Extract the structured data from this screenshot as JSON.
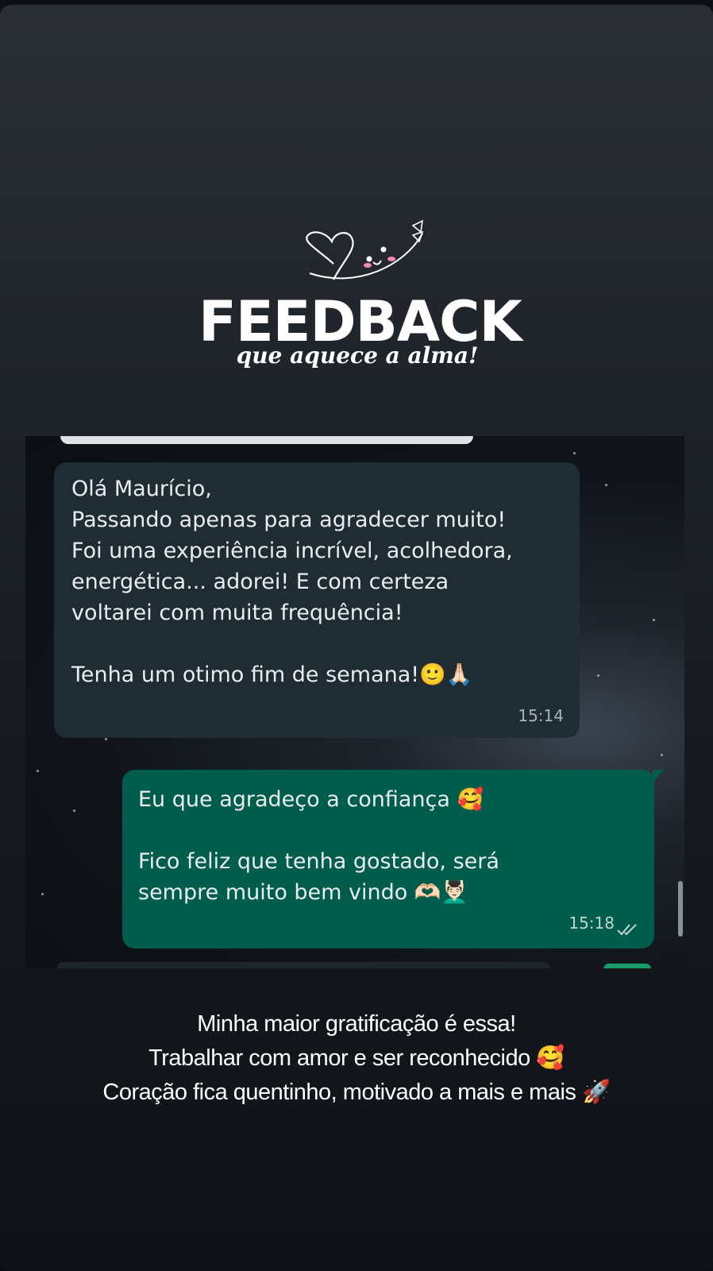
{
  "header": {
    "title": "FEEDBACK",
    "subtitle": "que aquece a alma!"
  },
  "chat": {
    "incoming": {
      "lines": [
        "Olá Maurício,",
        "Passando apenas para agradecer muito!",
        "Foi uma experiência incrível, acolhedora,",
        "energética... adorei! E com certeza",
        "voltarei com muita frequência!",
        "Tenha um otimo fim de semana!🙂🙏🏻"
      ],
      "time": "15:14"
    },
    "outgoing": {
      "lines": [
        "Eu que agradeço a confiança 🥰",
        "Fico feliz que tenha gostado, será",
        "sempre muito bem vindo 🫶🏻💆🏻‍♂️"
      ],
      "time": "15:18",
      "status_icon": "double-check-icon"
    }
  },
  "caption": {
    "lines": [
      "Minha maior gratificação é essa!",
      "Trabalhar com amor e ser reconhecido 🥰",
      "Coração fica quentinho, motivado a mais e mais 🚀"
    ]
  },
  "colors": {
    "incoming_bubble": "#202c33",
    "outgoing_bubble": "#005c4b",
    "background_top": "#2a2f35",
    "background_bottom": "#0f1217"
  }
}
